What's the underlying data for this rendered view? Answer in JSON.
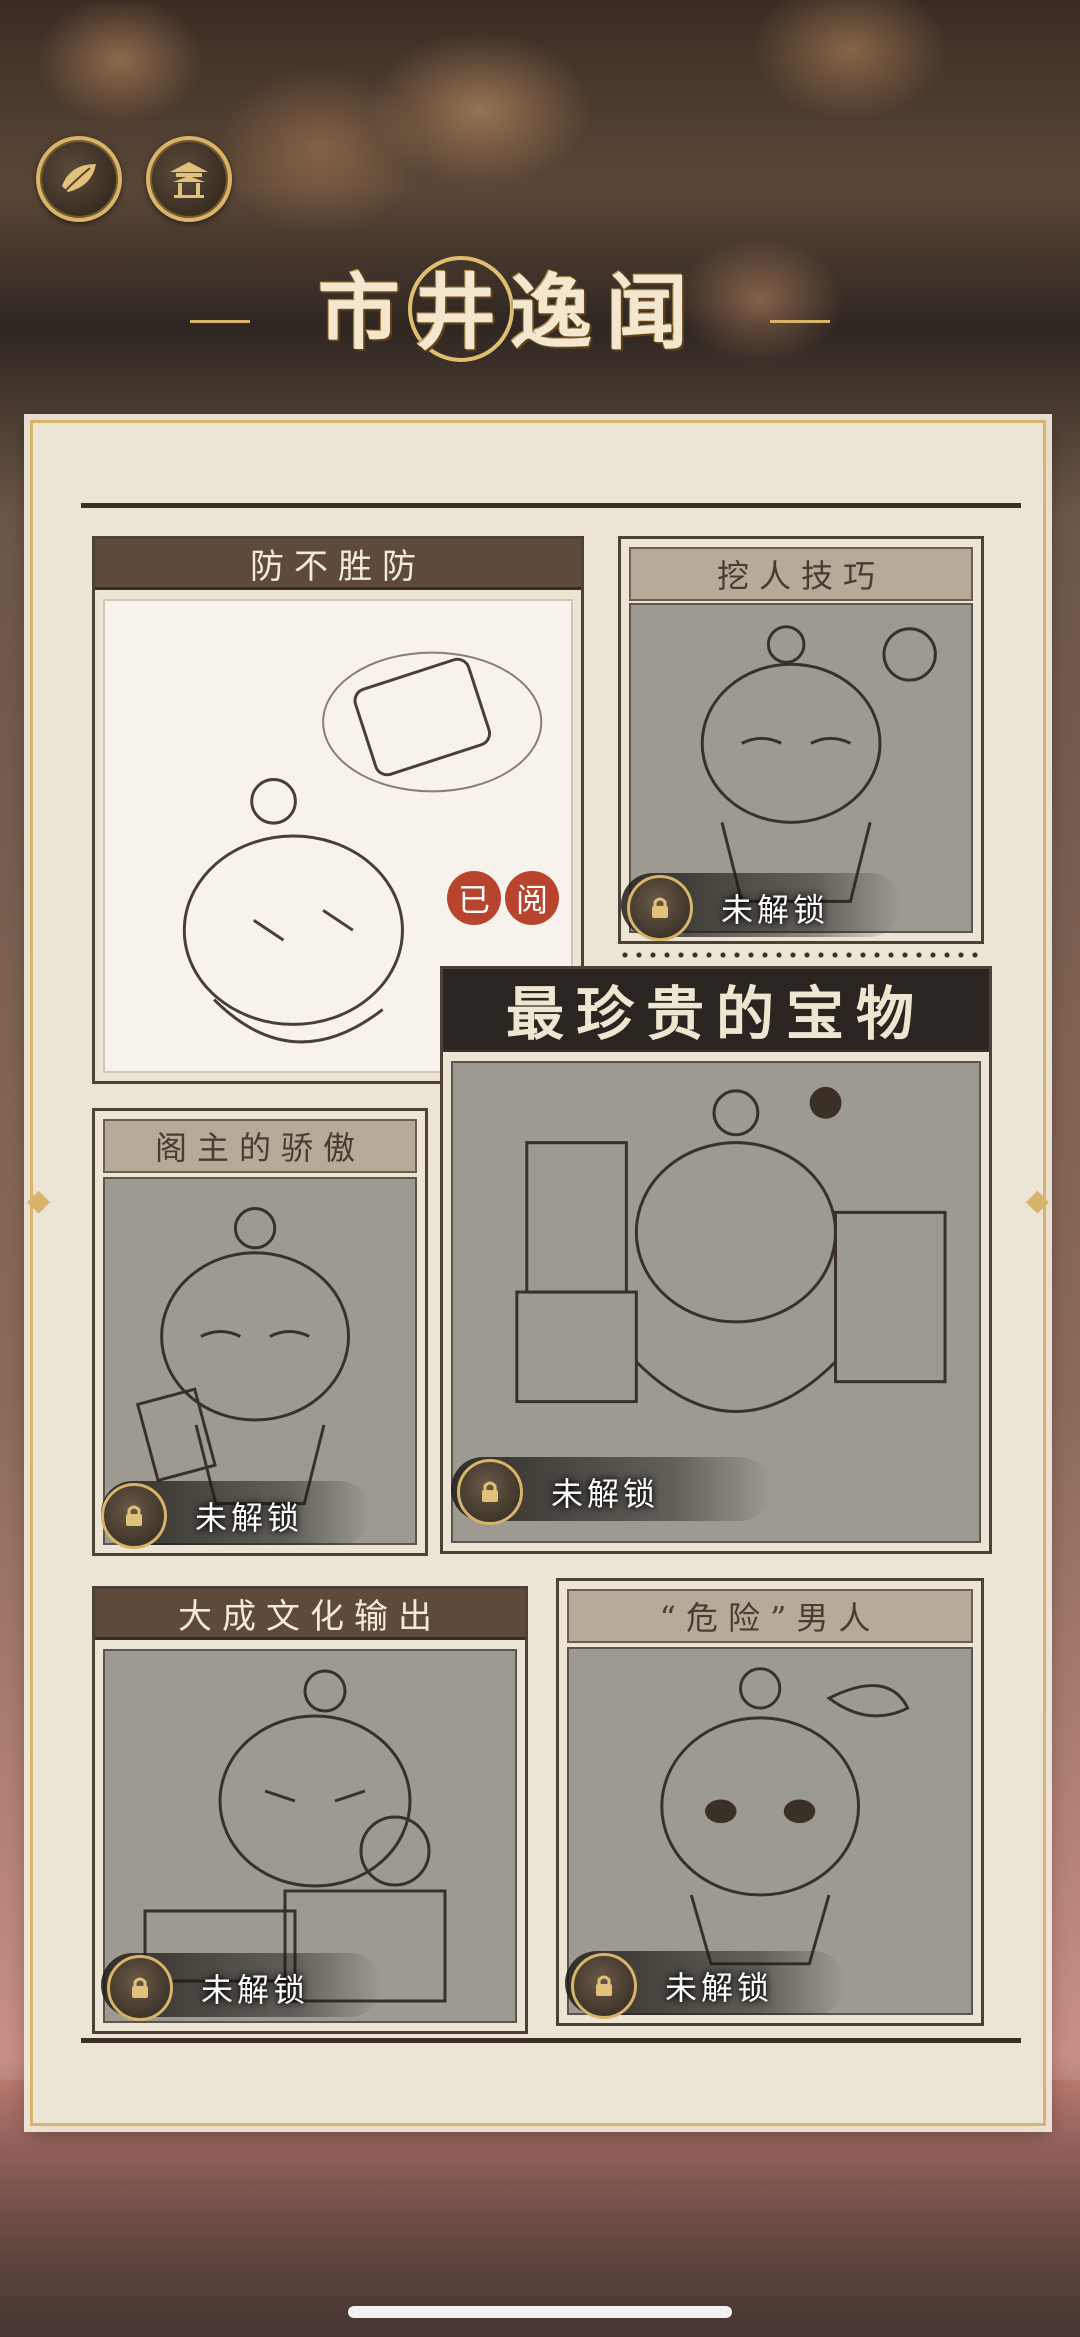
{
  "header": {
    "title_chars": [
      "市",
      "井",
      "逸",
      "闻"
    ],
    "left_button_icon": "leaf-icon",
    "right_button_icon": "pavilion-icon"
  },
  "cards": [
    {
      "title": "防不胜防",
      "status": "read",
      "badge": [
        "已",
        "阅"
      ]
    },
    {
      "title": "挖人技巧",
      "status": "locked",
      "lock_label": "未解锁"
    },
    {
      "title": "最珍贵的宝物",
      "status": "locked",
      "lock_label": "未解锁"
    },
    {
      "title": "阁主的骄傲",
      "status": "locked",
      "lock_label": "未解锁"
    },
    {
      "title": "大成文化输出",
      "status": "locked",
      "lock_label": "未解锁"
    },
    {
      "title": "“危险”男人",
      "status": "locked",
      "lock_label": "未解锁"
    }
  ],
  "colors": {
    "gold": "#d7b46a",
    "badge_red": "#b8442e",
    "locked_fill": "#9c9a91",
    "paper": "#ece5d6"
  }
}
